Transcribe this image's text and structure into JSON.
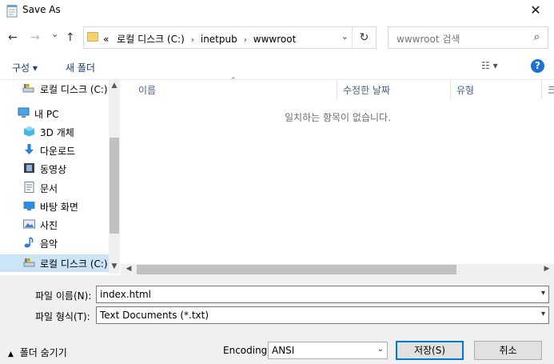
{
  "window": {
    "title": "Save As",
    "close_glyph": "✕"
  },
  "nav": {
    "back_glyph": "←",
    "forward_glyph": "→",
    "recent_glyph": "⌄",
    "up_glyph": "↑"
  },
  "address": {
    "prefix": "«",
    "segments": [
      "로컬 디스크 (C:)",
      "inetpub",
      "wwwroot"
    ],
    "separator": "›",
    "dropdown_glyph": "⌄",
    "refresh_glyph": "↻"
  },
  "search": {
    "placeholder": "wwwroot 검색",
    "icon_glyph": "⌕"
  },
  "toolbar": {
    "organize_label": "구성 ▾",
    "new_folder_label": "새 폴더",
    "view_glyph": "☷ ▾",
    "help_glyph": "?"
  },
  "sidebar": {
    "items": [
      {
        "label": "로컬 디스크 (C:)",
        "icon": "drive-icon"
      },
      {
        "label": "내 PC",
        "icon": "pc-icon"
      },
      {
        "label": "3D 개체",
        "icon": "3d-objects-icon"
      },
      {
        "label": "다운로드",
        "icon": "download-icon"
      },
      {
        "label": "동영상",
        "icon": "video-icon"
      },
      {
        "label": "문서",
        "icon": "document-icon"
      },
      {
        "label": "바탕 화면",
        "icon": "desktop-icon"
      },
      {
        "label": "사진",
        "icon": "pictures-icon"
      },
      {
        "label": "음악",
        "icon": "music-icon"
      },
      {
        "label": "로컬 디스크 (C:)",
        "icon": "drive-icon"
      }
    ]
  },
  "filelist": {
    "columns": [
      "이름",
      "수정한 날짜",
      "유형",
      "크"
    ],
    "empty_message": "일치하는 항목이 없습니다."
  },
  "form": {
    "filename_label": "파일 이름(N):",
    "filename_value": "index.html",
    "filetype_label": "파일 형식(T):",
    "filetype_value": "Text Documents (*.txt)",
    "encoding_label": "Encoding:",
    "encoding_value": "ANSI",
    "save_label": "저장(S)",
    "cancel_label": "취소",
    "hide_folders_label": "폴더 숨기기"
  },
  "colors": {
    "accent": "#0078d7",
    "selection": "#cce4f7",
    "help": "#1f6fd6"
  }
}
